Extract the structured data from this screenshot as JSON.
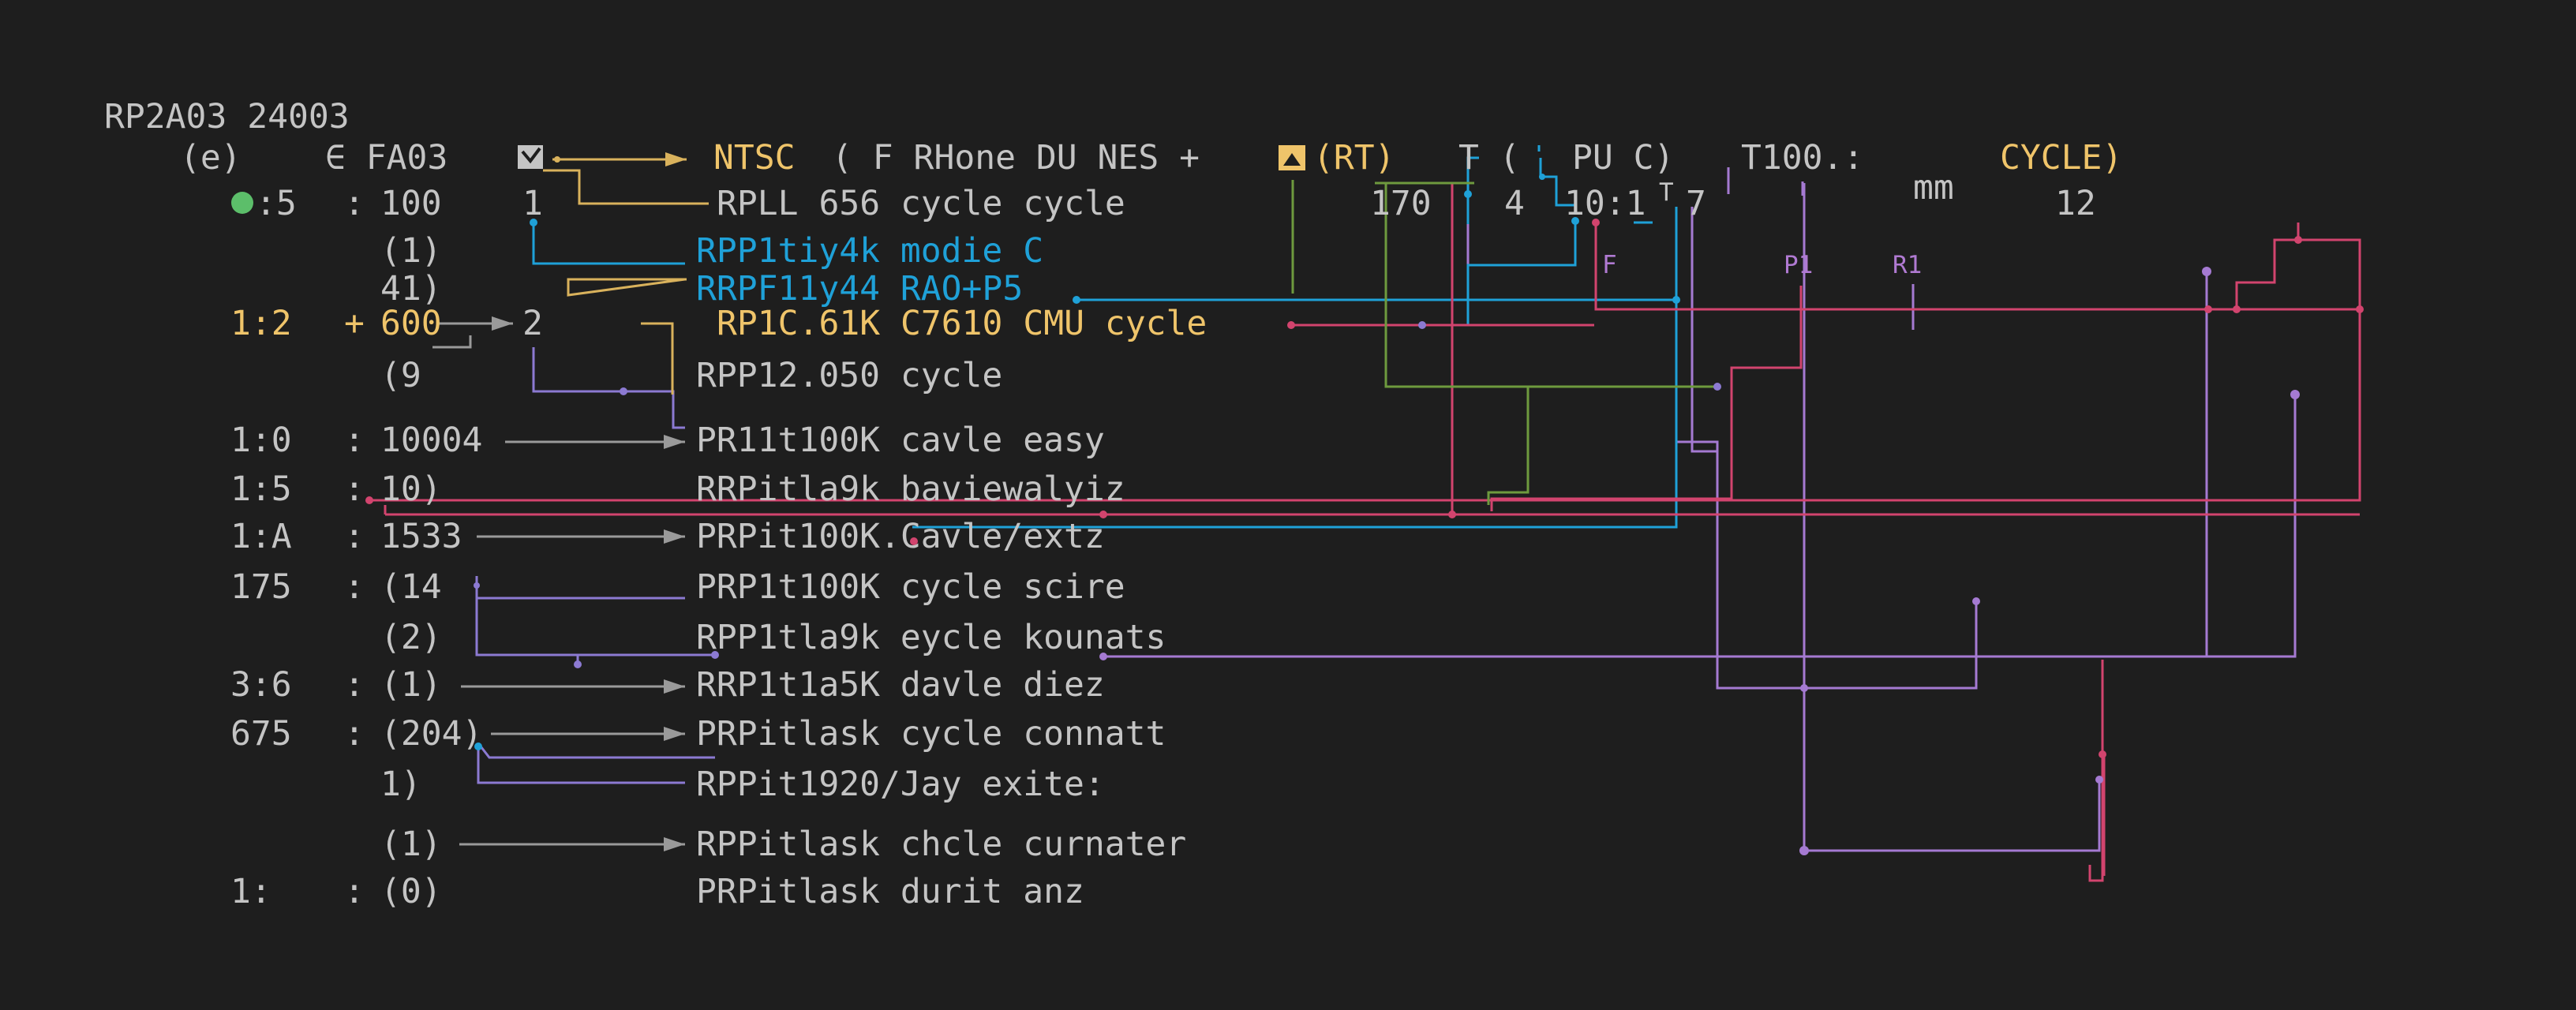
{
  "header": {
    "title": "RP2A03 24003",
    "row_e": "(e)",
    "row_fa03": "∈ FA03",
    "ntsc": "NTSC",
    "mid_text": "( F RHone DU NES +",
    "rt": "(RT)",
    "t_paren": "T (",
    "pu": "PU  C)",
    "t100": "T100.:",
    "cycle_end": "CYCLE)",
    "rpll": "RPLL 656 cycle cycle",
    "n170": "170",
    "n4": "4",
    "n10_1": "10:1",
    "t_small": "T",
    "n7": "7",
    "mm": "mm",
    "n12": "12"
  },
  "labels": {
    "f": "F",
    "p1": "P1",
    "r1": "R1"
  },
  "rows": [
    {
      "addr": "",
      "sep": "",
      "val": "(1)",
      "target": "RPP1tiy4k modie C",
      "color": "blue"
    },
    {
      "addr": "",
      "sep": "",
      "val": "41)",
      "target": "RRPF11y44 RAO+P5",
      "color": "blue"
    },
    {
      "addr": "1:2",
      "sep": "+",
      "val": "600",
      "target": "RP1C.61K C7610 CMU cycle",
      "color": "yellow"
    },
    {
      "addr": "",
      "sep": "",
      "val": "(9",
      "target": "RPP12.050 cycle",
      "color": "gray"
    },
    {
      "addr": "1:0",
      "sep": ":",
      "val": "10004",
      "target": "PR11t100K cavle easy",
      "color": "gray"
    },
    {
      "addr": "1:5",
      "sep": ":",
      "val": "10)",
      "target": "RRPitla9k baviewalyiz",
      "color": "gray"
    },
    {
      "addr": "1:A",
      "sep": ":",
      "val": "1533",
      "target": "PRPit100K.Cavle/extz",
      "color": "gray"
    },
    {
      "addr": "175",
      "sep": ":",
      "val": "(14",
      "target": "PRP1t100K cycle scire",
      "color": "gray"
    },
    {
      "addr": "",
      "sep": "",
      "val": "(2)",
      "target": "RPP1tla9k eycle kounats",
      "color": "gray"
    },
    {
      "addr": "3:6",
      "sep": ":",
      "val": "(1)",
      "target": "RRP1t1a5K davle diez",
      "color": "gray"
    },
    {
      "addr": "675",
      "sep": ":",
      "val": "(204)",
      "target": "PRPitlask cycle connatt",
      "color": "gray"
    },
    {
      "addr": "",
      "sep": "",
      "val": "1)",
      "target": "RPPit1920/Jay exite:",
      "color": "gray"
    },
    {
      "addr": "",
      "sep": "",
      "val": "(1)",
      "target": "RPPitlask chcle curnater",
      "color": "gray"
    },
    {
      "addr": "1:",
      "sep": ":",
      "val": "(0)",
      "target": "PRPitlask durit anz",
      "color": "gray"
    }
  ],
  "status_row": {
    "addr": ":5",
    "sep": ":",
    "val": "100",
    "num": "1"
  },
  "row_12_num": "2",
  "colors": {
    "background": "#1e1e1e",
    "text": "#c4c4c4",
    "yellow": "#efc46a",
    "blue": "#1fa1d8",
    "pink": "#d2446e",
    "purple": "#a57ad2",
    "green": "#6e9a3e",
    "status_dot": "#5cbe6a"
  }
}
